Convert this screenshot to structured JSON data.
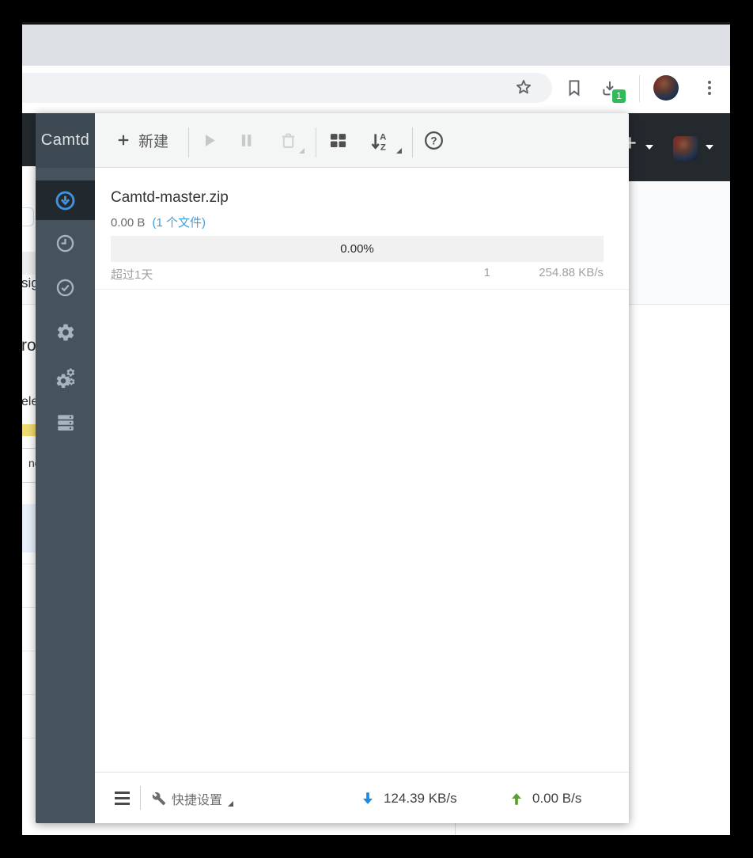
{
  "colors": {
    "accent_blue": "#3f92dc",
    "badge_green": "#2fbb58",
    "link_blue": "#3f9fdc",
    "speed_down_blue": "#1e88e5",
    "speed_up_green": "#5c9e31",
    "highlight_yellow": "#f2dd72",
    "sidebar_dark": "#46535d",
    "page_header_dark": "#24292e"
  },
  "icons": {
    "plus": "+",
    "question_mark": "?",
    "sort_letter_a": "A",
    "sort_letter_z": "Z"
  },
  "browser": {
    "download_badge": "1"
  },
  "background_page": {
    "fragments": {
      "hero": "sig",
      "heading": "ro",
      "subheading": "ele",
      "table_cell": "no"
    }
  },
  "popup": {
    "brand": "Camtd",
    "toolbar": {
      "new_label": "新建"
    },
    "downloads": [
      {
        "name": "Camtd-master.zip",
        "size": "0.00 B",
        "files": "(1 个文件)",
        "progress": "0.00%",
        "eta": "超过1天",
        "connections": "1",
        "speed": "254.88 KB/s"
      }
    ],
    "statusbar": {
      "quick_settings": "快捷设置",
      "download_speed": "124.39 KB/s",
      "upload_speed": "0.00 B/s"
    }
  }
}
